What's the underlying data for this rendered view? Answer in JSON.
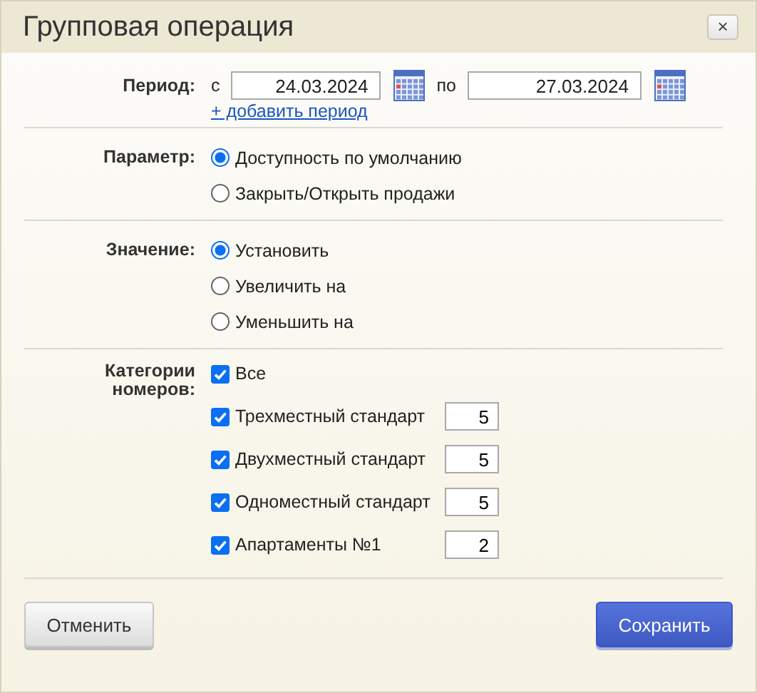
{
  "window": {
    "title": "Групповая операция",
    "close": "×"
  },
  "period": {
    "label": "Период:",
    "from_label": "с",
    "from": "24.03.2024",
    "to_label": "по",
    "to": "27.03.2024",
    "add_link": "+ добавить период"
  },
  "parameter": {
    "label": "Параметр:",
    "options": [
      {
        "label": "Доступность по умолчанию",
        "selected": true
      },
      {
        "label": "Закрыть/Открыть продажи",
        "selected": false
      }
    ]
  },
  "value": {
    "label": "Значение:",
    "options": [
      {
        "label": "Установить",
        "selected": true
      },
      {
        "label": "Увеличить на",
        "selected": false
      },
      {
        "label": "Уменьшить на",
        "selected": false
      }
    ]
  },
  "categories": {
    "label": "Категории номеров:",
    "all": {
      "label": "Все",
      "checked": true
    },
    "items": [
      {
        "label": "Трехместный стандарт",
        "checked": true,
        "value": "5"
      },
      {
        "label": "Двухместный стандарт",
        "checked": true,
        "value": "5"
      },
      {
        "label": "Одноместный стандарт",
        "checked": true,
        "value": "5"
      },
      {
        "label": "Апартаменты №1",
        "checked": true,
        "value": "2"
      }
    ]
  },
  "buttons": {
    "cancel": "Отменить",
    "save": "Сохранить"
  }
}
